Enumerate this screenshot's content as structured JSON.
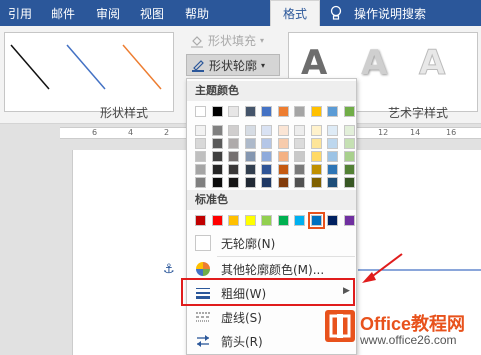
{
  "tabs": [
    {
      "label": "引用"
    },
    {
      "label": "邮件"
    },
    {
      "label": "审阅"
    },
    {
      "label": "视图"
    },
    {
      "label": "帮助"
    },
    {
      "label": "格式"
    },
    {
      "label": "操作说明搜索"
    }
  ],
  "ribbon": {
    "shape_fill_label": "形状填充",
    "shape_outline_label": "形状轮廓",
    "shape_styles_label": "形状样式",
    "wordart_styles_label": "艺术字样式",
    "wordart_letter": "A"
  },
  "ruler": {
    "numbers": [
      "6",
      "4",
      "2",
      "12",
      "14",
      "16"
    ]
  },
  "menu": {
    "theme_colors_title": "主题颜色",
    "standard_colors_title": "标准色",
    "theme_top_row": [
      "#ffffff",
      "#000000",
      "#e7e6e6",
      "#44546a",
      "#4472c4",
      "#ed7d31",
      "#a5a5a5",
      "#ffc000",
      "#5b9bd5",
      "#70ad47"
    ],
    "theme_shades": [
      [
        "#f2f2f2",
        "#808080",
        "#d0cece",
        "#d6dce4",
        "#d9e2f3",
        "#fbe5d5",
        "#ededed",
        "#fff2cc",
        "#deebf6",
        "#e2efd9"
      ],
      [
        "#d8d8d8",
        "#595959",
        "#aeaaaa",
        "#adb9ca",
        "#b4c6e7",
        "#f7cbac",
        "#dbdbdb",
        "#fee599",
        "#bdd7ee",
        "#c5e0b3"
      ],
      [
        "#bfbfbf",
        "#3f3f3f",
        "#757070",
        "#8496b0",
        "#8eaadb",
        "#f4b183",
        "#c9c9c9",
        "#ffd965",
        "#9cc3e5",
        "#a8d08d"
      ],
      [
        "#a5a5a5",
        "#262626",
        "#3a3838",
        "#323f4f",
        "#2f5496",
        "#c55a11",
        "#7b7b7b",
        "#bf8f00",
        "#2e75b5",
        "#538135"
      ],
      [
        "#7f7f7f",
        "#0c0c0c",
        "#171616",
        "#222a35",
        "#1f3864",
        "#833c0b",
        "#525252",
        "#7f6000",
        "#1e4e79",
        "#375623"
      ]
    ],
    "standard_colors": [
      "#c00000",
      "#ff0000",
      "#ffc000",
      "#ffff00",
      "#92d050",
      "#00b050",
      "#00b0f0",
      "#0070c0",
      "#002060",
      "#7030a0"
    ],
    "no_outline": "无轮廓(N)",
    "more_colors": "其他轮廓颜色(M)...",
    "weight": "粗细(W)",
    "dashes": "虚线(S)",
    "arrows": "箭头(R)"
  },
  "watermark": {
    "name": "Office教程网",
    "url": "www.office26.com"
  },
  "colors": {
    "accent": "#2b579a",
    "highlight": "#e01c1c",
    "logo": "#e8521c"
  }
}
